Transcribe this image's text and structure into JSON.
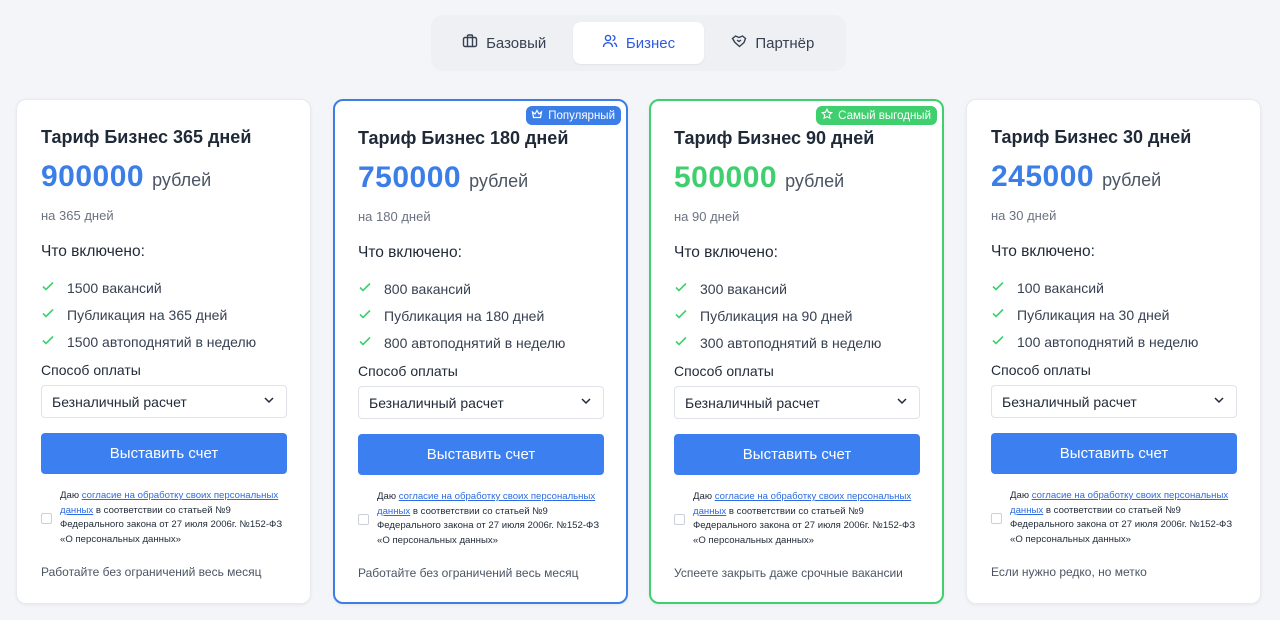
{
  "tabs": [
    {
      "label": "Базовый",
      "icon": "briefcase-icon",
      "active": false
    },
    {
      "label": "Бизнес",
      "icon": "users-icon",
      "active": true
    },
    {
      "label": "Партнёр",
      "icon": "handshake-icon",
      "active": false
    }
  ],
  "colors": {
    "accent_blue": "#3b7ff0",
    "accent_green": "#3fcf6f",
    "price_blue": "#3b7ee8",
    "price_green": "#3fcf6f"
  },
  "common": {
    "included_label": "Что включено:",
    "payment_label": "Способ оплаты",
    "payment_selected": "Безналичный расчет",
    "button_label": "Выставить счет",
    "consent_prefix": "Даю ",
    "consent_link": "согласие на обработку своих персональных данных",
    "consent_suffix": " в соответствии со статьей №9 Федерального закона от 27 июля 2006г. №152-ФЗ «О персональных данных»"
  },
  "cards": [
    {
      "title": "Тариф Бизнес 365 дней",
      "price": "900000",
      "currency": "рублей",
      "period": "на 365 дней",
      "features": [
        "1500 вакансий",
        "Публикация на 365 дней",
        "1500 автоподнятий в неделю"
      ],
      "note": "Работайте без ограничений весь месяц"
    },
    {
      "title": "Тариф Бизнес 180 дней",
      "price": "750000",
      "currency": "рублей",
      "period": "на 180 дней",
      "badge": "Популярный",
      "features": [
        "800 вакансий",
        "Публикация на 180 дней",
        "800 автоподнятий в неделю"
      ],
      "note": "Работайте без ограничений весь месяц"
    },
    {
      "title": "Тариф Бизнес 90 дней",
      "price": "500000",
      "currency": "рублей",
      "period": "на 90 дней",
      "badge": "Самый выгодный",
      "features": [
        "300 вакансий",
        "Публикация на 90 дней",
        "300 автоподнятий в неделю"
      ],
      "note": "Успеете закрыть даже срочные вакансии"
    },
    {
      "title": "Тариф Бизнес 30 дней",
      "price": "245000",
      "currency": "рублей",
      "period": "на 30 дней",
      "features": [
        "100 вакансий",
        "Публикация на 30 дней",
        "100 автоподнятий в неделю"
      ],
      "note": "Если нужно редко, но метко"
    }
  ]
}
